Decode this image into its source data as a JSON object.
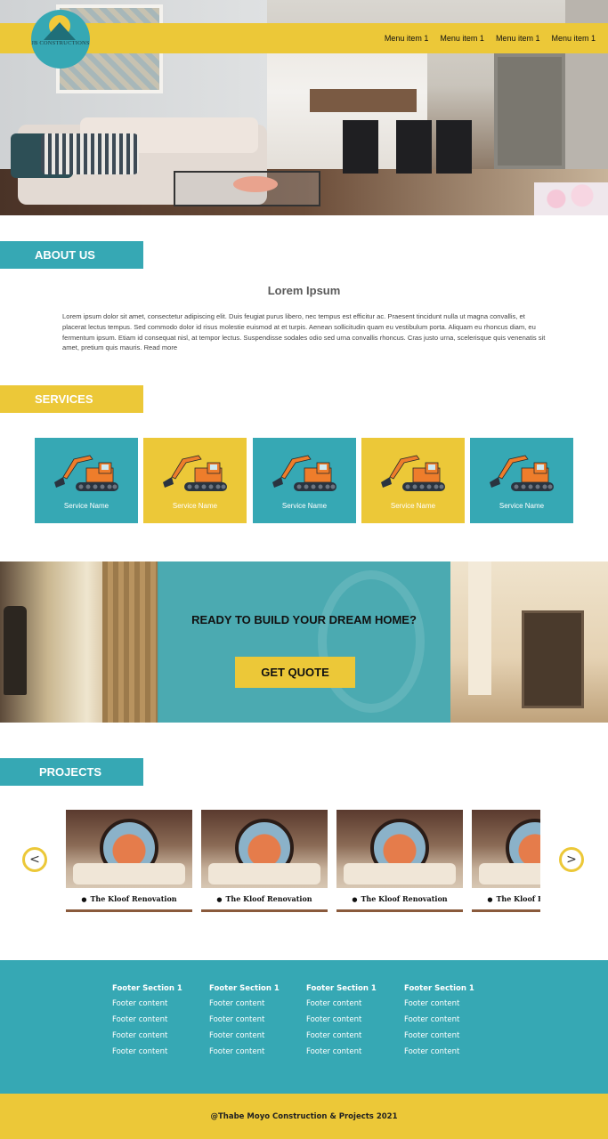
{
  "brand": {
    "logo_text": "JB CONSTRUCTIONS"
  },
  "nav": {
    "items": [
      "Menu item 1",
      "Menu item 1",
      "Menu item 1",
      "Menu item 1"
    ]
  },
  "colors": {
    "teal": "#36a8b4",
    "yellow": "#ecc838"
  },
  "about": {
    "heading": "ABOUT US",
    "title": "Lorem Ipsum",
    "text": "Lorem ipsum dolor sit amet, consectetur adipiscing elit. Duis feugiat purus libero, nec tempus est efficitur ac.  Praesent tincidunt nulla ut magna convallis, et placerat lectus tempus. Sed commodo dolor id risus molestie euismod at et turpis. Aenean sollicitudin quam eu vestibulum porta. Aliquam eu rhoncus diam, eu fermentum ipsum. Etiam id consequat nisl, at tempor lectus. Suspendisse sodales odio sed urna convallis rhoncus. Cras justo urna, scelerisque quis venenatis sit amet, pretium quis mauris. Read more"
  },
  "services": {
    "heading": "SERVICES",
    "icon": "excavator-icon",
    "items": [
      {
        "name": "Service Name",
        "color": "#36a8b4"
      },
      {
        "name": "Service Name",
        "color": "#ecc838"
      },
      {
        "name": "Service Name",
        "color": "#36a8b4"
      },
      {
        "name": "Service Name",
        "color": "#ecc838"
      },
      {
        "name": "Service Name",
        "color": "#36a8b4"
      }
    ]
  },
  "cta": {
    "title": "READY TO BUILD YOUR DREAM HOME?",
    "button": "GET QUOTE"
  },
  "projects": {
    "heading": "PROJECTS",
    "prev": "<",
    "next": ">",
    "items": [
      {
        "title": "The Kloof Renovation"
      },
      {
        "title": "The Kloof Renovation"
      },
      {
        "title": "The Kloof Renovation"
      },
      {
        "title": "The Kloof Renovation"
      }
    ]
  },
  "footer": {
    "columns": [
      {
        "heading": "Footer Section 1",
        "items": [
          "Footer content",
          "Footer content",
          "Footer content",
          "Footer content"
        ]
      },
      {
        "heading": "Footer Section 1",
        "items": [
          "Footer content",
          "Footer content",
          "Footer content",
          "Footer content"
        ]
      },
      {
        "heading": "Footer Section 1",
        "items": [
          "Footer content",
          "Footer content",
          "Footer content",
          "Footer content"
        ]
      },
      {
        "heading": "Footer Section 1",
        "items": [
          "Footer content",
          "Footer content",
          "Footer content",
          "Footer content"
        ]
      }
    ],
    "copyright": "@Thabe Moyo Construction & Projects 2021"
  }
}
